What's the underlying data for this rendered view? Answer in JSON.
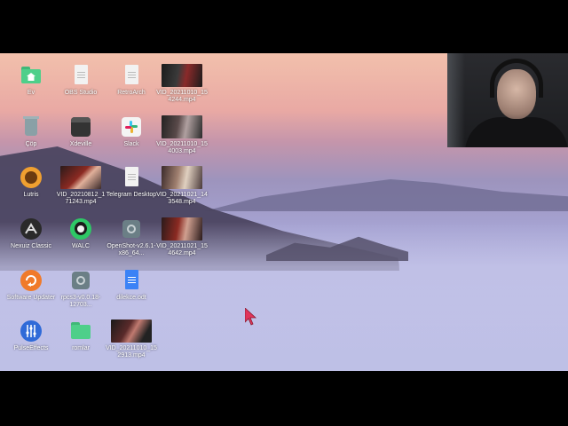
{
  "desktop": {
    "icons": [
      {
        "label": "Ev",
        "icon": "home-folder-icon",
        "color": "#4ecf8a"
      },
      {
        "label": "OBS Studio",
        "icon": "document-icon"
      },
      {
        "label": "RetroArch",
        "icon": "document-icon"
      },
      {
        "label": "VID_20211010_154244.mp4",
        "icon": "video-thumbnail"
      },
      {
        "label": "Çöp",
        "icon": "trash-icon"
      },
      {
        "label": "Xdeville",
        "icon": "app-icon"
      },
      {
        "label": "Slack",
        "icon": "slack-icon"
      },
      {
        "label": "VID_20211010_154003.mp4",
        "icon": "video-thumbnail"
      },
      {
        "label": "Lutris",
        "icon": "lutris-icon",
        "color": "#f0a030"
      },
      {
        "label": "VID_20210812_171243.mp4",
        "icon": "video-thumbnail"
      },
      {
        "label": "Telegram Desktop",
        "icon": "document-icon"
      },
      {
        "label": "VID_20211021_143548.mp4",
        "icon": "video-thumbnail"
      },
      {
        "label": "Nexuiz Classic",
        "icon": "nexuiz-icon"
      },
      {
        "label": "WALC",
        "icon": "whatsapp-icon",
        "color": "#2ec866"
      },
      {
        "label": "OpenShot-v2.6.1-x86_64...",
        "icon": "gear-icon"
      },
      {
        "label": "VID_20211021_154642.mp4",
        "icon": "video-thumbnail"
      },
      {
        "label": "Software Updater",
        "icon": "updater-icon",
        "color": "#f07a2a"
      },
      {
        "label": "rpcs3-v0.0.18-12703...",
        "icon": "gear-icon"
      },
      {
        "label": "dilekce.odt",
        "icon": "text-document-icon",
        "color": "#3b82f6"
      },
      {
        "label": "PulseEffects",
        "icon": "pulseeffects-icon",
        "color": "#2f6ad8"
      },
      {
        "label": "romlar",
        "icon": "folder-icon",
        "color": "#4ecf8a"
      },
      {
        "label": "VID_20211010_152913.mp4",
        "icon": "video-thumbnail"
      }
    ]
  },
  "webcam": {
    "icon": "webcam-overlay"
  }
}
